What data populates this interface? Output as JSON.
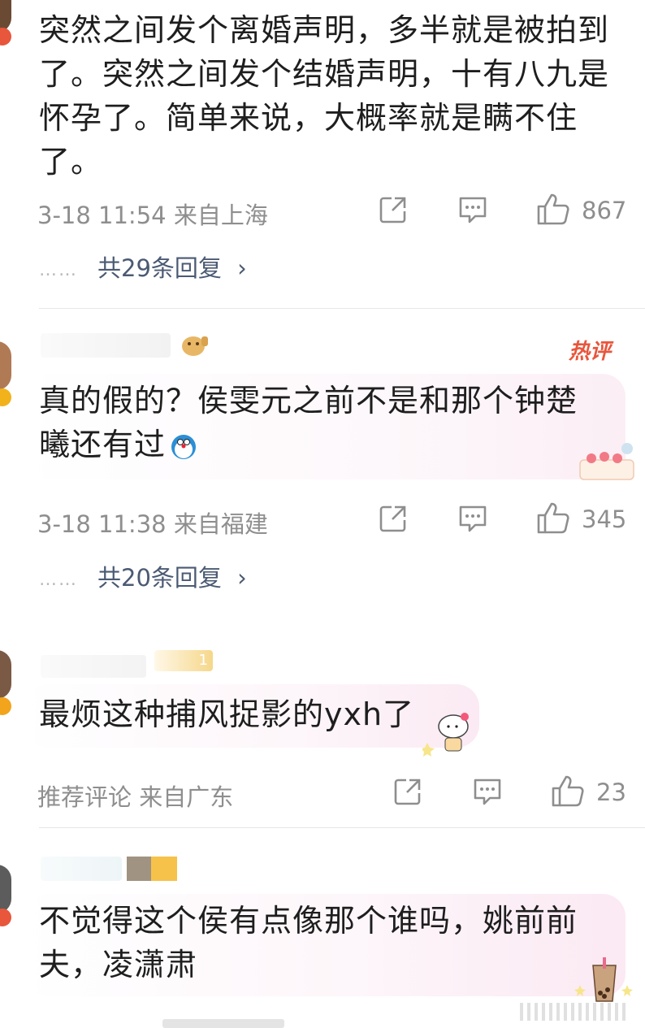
{
  "comments": [
    {
      "text": "突然之间发个离婚声明，多半就是被拍到了。突然之间发个结婚声明，十有八九是怀孕了。简单来说，大概率就是瞒不住了。",
      "lines": [
        "突然之间发个离婚声明，多半就是被拍到",
        "了。突然之间发个结婚声明，十有八九是",
        "怀孕了。简单来说，大概率就是瞒不住",
        "了。"
      ],
      "meta": "3-18 11:54 来自上海",
      "likes": "867",
      "replies": "共29条回复",
      "dots": "……"
    },
    {
      "hot_badge": "热评",
      "lines": [
        "真的假的？侯雯元之前不是和那个钟楚",
        "曦还有过"
      ],
      "meta": "3-18 11:38 来自福建",
      "likes": "345",
      "replies": "共20条回复",
      "dots": "……"
    },
    {
      "badge": "1",
      "lines": [
        "最烦这种捕风捉影的yxh了"
      ],
      "meta": "推荐评论 来自广东",
      "likes": "23"
    },
    {
      "lines": [
        "不觉得这个侯有点像那个谁吗，姚前前",
        "夫，凌潇肃"
      ]
    }
  ],
  "icons": {
    "share": "share-icon",
    "comment": "comment-icon",
    "like": "thumbs-up-icon",
    "chevron": "chevron-right-icon"
  },
  "colors": {
    "text": "#1e1e1e",
    "meta": "#8e8e8e",
    "reply_link": "#4b5a73",
    "hot": "#e8563c"
  }
}
